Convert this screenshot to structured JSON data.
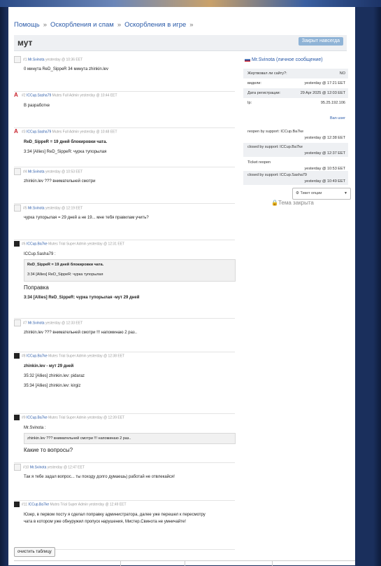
{
  "breadcrumbs": [
    "Помощь",
    "Оскорбления и спам",
    "Оскорбления в игре"
  ],
  "breadcrumb_sep": "»",
  "thread_title": "мут",
  "close_forever_label": "Закрыт навсегда",
  "posts": [
    {
      "num": "#1",
      "author": "Mr.Svinota",
      "role": "",
      "time": "yesterday @ 10:36 EET",
      "icon": "user",
      "lines": [
        "0 минута ReD_SippeR 34 минута zhinkin.lev"
      ]
    },
    {
      "num": "#2",
      "author": "ICCup.Sasha79",
      "role": "Mutes Full Admin",
      "time": "yesterday @ 10:44 EET",
      "icon": "iccup",
      "lines": [
        "В разработке"
      ]
    },
    {
      "num": "#3",
      "author": "ICCup.Sasha79",
      "role": "Mutes Full Admin",
      "time": "yesterday @ 10:48 EET",
      "icon": "iccup",
      "lines": [
        "ReD_SippeR = 19 дней блокировки чата.",
        "3:34 [Allies] ReD_SippeR: чурка тупорылая"
      ]
    },
    {
      "num": "#4",
      "author": "Mr.Svinota",
      "role": "",
      "time": "yesterday @ 10:53 EET",
      "icon": "user",
      "lines": [
        "zhinkin.lev ??? внимательней смотри"
      ]
    },
    {
      "num": "#5",
      "author": "Mr.Svinota",
      "role": "",
      "time": "yesterday @ 12:19 EET",
      "icon": "user",
      "lines": [
        "чурка тупорылая = 29 дней а не 19... мне тебя правилам учить?"
      ]
    },
    {
      "num": "#6",
      "author": "ICCup.Ba7ke",
      "role": "Mutes Trial Super Admin",
      "time": "yesterday @ 12:31 EET",
      "icon": "dark",
      "lines": [
        "ICCup.Sasha79 :",
        "Поправка",
        "3:34 [Allies] ReD_SippeR: чурка тупорылая -мут 29 дней"
      ],
      "quote": [
        "ReD_SippeR = 19 дней блокировки чата.",
        "3:34 [Allies] ReD_SippeR: чурка тупорылая"
      ]
    },
    {
      "num": "#7",
      "author": "Mr.Svinota",
      "role": "",
      "time": "yesterday @ 12:33 EET",
      "icon": "user",
      "lines": [
        "zhinkin.lev ??? внимательней смотри !!! напоминаю 2 раз.."
      ]
    },
    {
      "num": "#8",
      "author": "ICCup.Ba7ke",
      "role": "Mutes Trial Super Admin",
      "time": "yesterday @ 12:38 EET",
      "icon": "dark",
      "lines": [
        "zhinkin.lev - мут 29 дней",
        "35:32 [Allies] zhinkin.lev: pidaraz",
        "35:34 [Allies] zhinkin.lev: kirgiz"
      ]
    },
    {
      "num": "#9",
      "author": "ICCup.Ba7ke",
      "role": "Mutes Trial Super Admin",
      "time": "yesterday @ 12:39 EET",
      "icon": "dark",
      "lines": [
        "Mr.Svinota :",
        "Какие то вопросы?"
      ],
      "quote": [
        "zhinkin.lev ??? внимательней смотри !!! напоминаю 2 раз.."
      ]
    },
    {
      "num": "#10",
      "author": "Mr.Svinota",
      "role": "",
      "time": "yesterday @ 12:47 EET",
      "icon": "user",
      "lines": [
        "Так я тебе задал вопрос... ты походу долго думаешь) работай не отвлекайся!"
      ]
    },
    {
      "num": "#11",
      "author": "ICCup.Ba7ke",
      "role": "Mutes Trial Super Admin",
      "time": "yesterday @ 12:49 EET",
      "icon": "dark",
      "lines": [
        "Юзер, в первом посту я сделал поправку администратора, далее уже перешел к пересмотру",
        "чата в котором уже обнуружил пропуск нарушения, Мистер.Свинота не умничайте!"
      ]
    }
  ],
  "clear_table_label": "очистить таблицу",
  "panel": {
    "user_label": "Mr.Svinota",
    "user_suffix": "(личное сообщение)",
    "rows": [
      {
        "k": "Жертвовал ли сайту?:",
        "v": "NO"
      },
      {
        "k": "видели:",
        "v": "yesterday @ 17:21 EET"
      },
      {
        "k": "Дата регистрации:",
        "v": "29 Apr 2025 @ 12:03 EET"
      },
      {
        "k": "Ip:",
        "v": "95.25.192.106"
      }
    ],
    "ban_user": "Ban user",
    "history": [
      {
        "a": "reopen by support: ICCup.Ba7ke",
        "d": "yesterday @ 12:38 EET"
      },
      {
        "a": "closed by support: ICCup.Ba7ke",
        "d": "yesterday @ 12:37 EET"
      },
      {
        "a": "Ticket reopen",
        "d": "yesterday @ 10:53 EET"
      },
      {
        "a": "closed by support: ICCup.Sasha79",
        "d": "yesterday @ 10:49 EET"
      }
    ],
    "ticket_options": "Тикет опции",
    "topic_closed": "Тема закрыта"
  },
  "colors": {
    "link": "#2a5aa8",
    "close_button": "#8fb3d6",
    "panel_gray": "#eef0f3"
  },
  "icons": {
    "lock": "lock-icon",
    "gear": "gear-icon",
    "flag": "flag-icon"
  }
}
